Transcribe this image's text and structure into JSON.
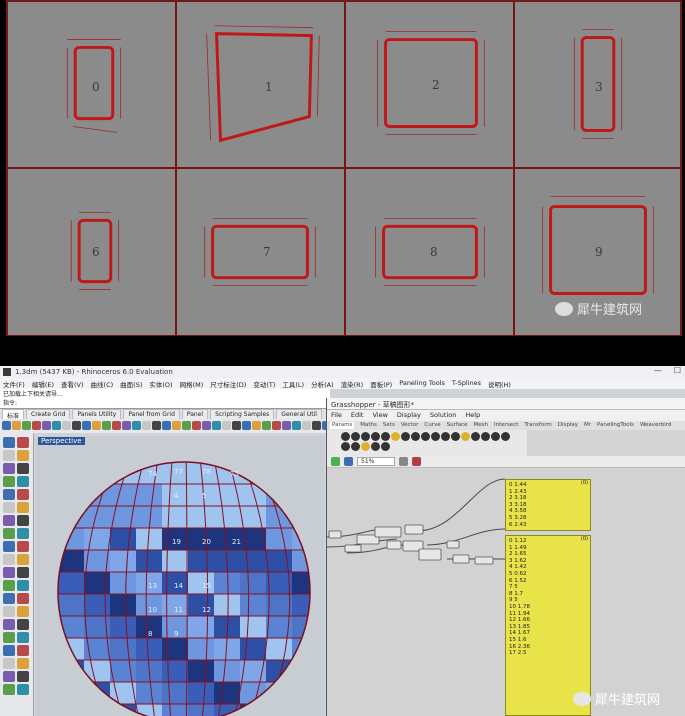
{
  "grid": {
    "cells": [
      {
        "label": "0"
      },
      {
        "label": "1"
      },
      {
        "label": "2"
      },
      {
        "label": "3"
      },
      {
        "label": "6"
      },
      {
        "label": "7"
      },
      {
        "label": "8"
      },
      {
        "label": "9"
      }
    ],
    "watermark": "犀牛建筑网"
  },
  "rhino": {
    "title": "1.3dm (5437 KB) - Rhinoceros 6.0 Evaluation",
    "menu": [
      "文件(F)",
      "编辑(E)",
      "查看(V)",
      "曲线(C)",
      "曲面(S)",
      "实体(O)",
      "网格(M)",
      "尺寸标注(D)",
      "变动(T)",
      "工具(L)",
      "分析(A)",
      "渲染(R)",
      "面板(P)",
      "Paneling Tools",
      "T-Splines",
      "说明(H)"
    ],
    "command_line1": "已加载上下相关请导...",
    "command_line2": "指令:",
    "tabs": [
      "标准",
      "Create Grid",
      "Panels Utility",
      "Panel from Grid",
      "Panel",
      "Scripting Samples",
      "General Util"
    ],
    "viewport_label": "Perspective",
    "sphere_numbers": [
      "74",
      "77",
      "78",
      "75",
      "4",
      "5",
      "19",
      "20",
      "21",
      "13",
      "14",
      "15",
      "10",
      "11",
      "12",
      "8",
      "9"
    ]
  },
  "grasshopper": {
    "title": "Grasshopper - 草稿图形*",
    "menu": [
      "File",
      "Edit",
      "View",
      "Display",
      "Solution",
      "Help"
    ],
    "tabs": [
      "Params",
      "Maths",
      "Sets",
      "Vector",
      "Curve",
      "Surface",
      "Mesh",
      "Intersect",
      "Transform",
      "Display",
      "Mr",
      "PanelingTools",
      "Weaverbird"
    ],
    "zoom": "51%",
    "panel1": {
      "header": "(0)",
      "rows": [
        "0 1.44",
        "1 2.43",
        "2 3.18",
        "3 3.18",
        "4 3.58",
        "5 3.28",
        "6 2.43"
      ]
    },
    "panel2": {
      "header": "(0)",
      "rows": [
        "0 1.12",
        "1 1.49",
        "2 1.65",
        "3 1.62",
        "4 1.42",
        "5 0.62",
        "6 1.52",
        "7 5",
        "8 1.7",
        "9 5",
        "10 1.78",
        "11 1.94",
        "12 1.66",
        "13 1.85",
        "14 1.67",
        "15 1.6",
        "16 2.36",
        "17 2.5"
      ]
    },
    "watermark": "犀牛建筑网"
  }
}
